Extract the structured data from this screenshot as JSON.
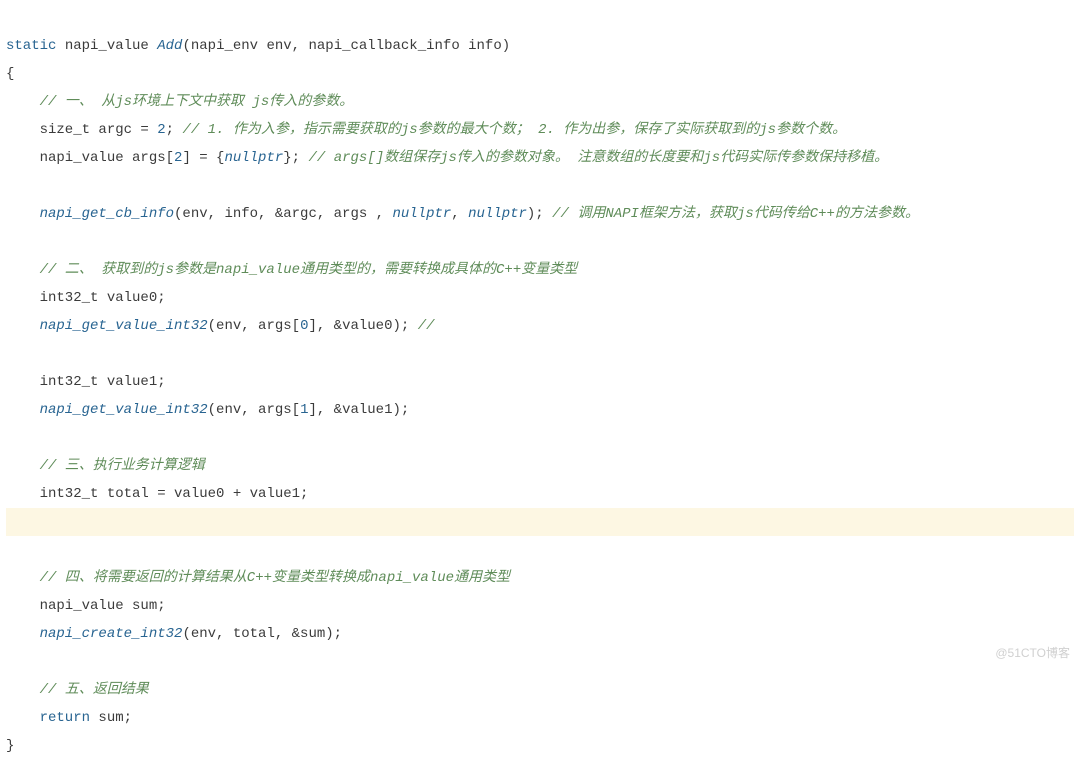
{
  "code": {
    "l1_a": "static",
    "l1_b": " napi_value ",
    "l1_c": "Add",
    "l1_d": "(napi_env env, napi_callback_info info)",
    "l2": "{",
    "l3": "    // 一、 从js环境上下文中获取 js传入的参数。",
    "l4_a": "    size_t argc = ",
    "l4_b": "2",
    "l4_c": "; ",
    "l4_d": "// 1. 作为入参，指示需要获取的js参数的最大个数； 2. 作为出参，保存了实际获取到的js参数个数。",
    "l5_a": "    napi_value args[",
    "l5_b": "2",
    "l5_c": "] = {",
    "l5_d": "nullptr",
    "l5_e": "}; ",
    "l5_f": "// args[]数组保存js传入的参数对象。 注意数组的长度要和js代码实际传参数保持移植。",
    "l7_a": "    napi_get_cb_info",
    "l7_b": "(env, info, &argc, args , ",
    "l7_c": "nullptr",
    "l7_d": ", ",
    "l7_e": "nullptr",
    "l7_f": "); ",
    "l7_g": "// 调用NAPI框架方法，获取js代码传给C++的方法参数。",
    "l9": "    // 二、 获取到的js参数是napi_value通用类型的，需要转换成具体的C++变量类型",
    "l10": "    int32_t value0;",
    "l11_a": "    napi_get_value_int32",
    "l11_b": "(env, args[",
    "l11_c": "0",
    "l11_d": "], &value0); ",
    "l11_e": "//",
    "l13": "    int32_t value1;",
    "l14_a": "    napi_get_value_int32",
    "l14_b": "(env, args[",
    "l14_c": "1",
    "l14_d": "], &value1);",
    "l16": "    // 三、执行业务计算逻辑",
    "l17": "    int32_t total = value0 + value1;",
    "l19": "    // 四、将需要返回的计算结果从C++变量类型转换成napi_value通用类型",
    "l20": "    napi_value sum;",
    "l21_a": "    napi_create_int32",
    "l21_b": "(env, total, &sum);",
    "l23": "    // 五、返回结果",
    "l24_a": "    return",
    "l24_b": " sum;",
    "l25": "}"
  },
  "watermark": "@51CTO博客"
}
